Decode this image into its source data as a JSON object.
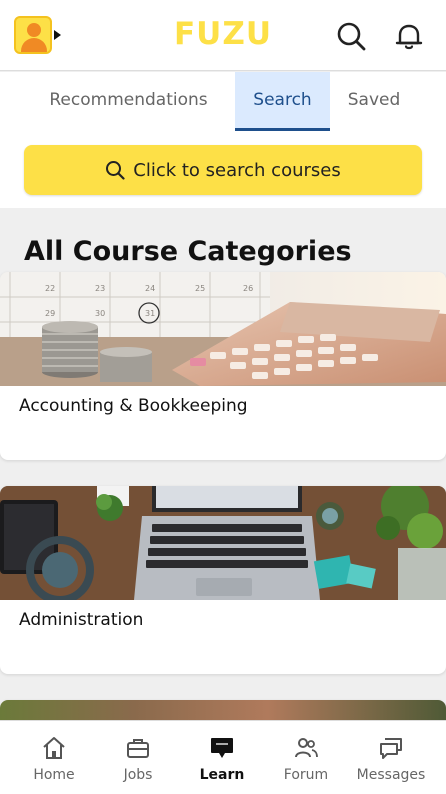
{
  "header": {
    "brand": "FUZU",
    "icons": [
      "avatar-icon",
      "search-icon",
      "bell-icon"
    ],
    "brand_color": "#fde047"
  },
  "tabs": [
    {
      "label": "Recommendations",
      "active": false
    },
    {
      "label": "Search",
      "active": true
    },
    {
      "label": "Saved",
      "active": false
    }
  ],
  "search": {
    "button_label": "Click to search courses",
    "icon": "search-icon"
  },
  "main": {
    "section_title": "All Course Categories",
    "categories": [
      {
        "label": "Accounting & Bookkeeping",
        "image": "calendar-calculator-coins"
      },
      {
        "label": "Administration",
        "image": "laptop-desk-plants"
      }
    ]
  },
  "bottom_nav": [
    {
      "label": "Home",
      "icon": "home-icon",
      "active": false
    },
    {
      "label": "Jobs",
      "icon": "briefcase-icon",
      "active": false
    },
    {
      "label": "Learn",
      "icon": "chalkboard-icon",
      "active": true
    },
    {
      "label": "Forum",
      "icon": "people-icon",
      "active": false
    },
    {
      "label": "Messages",
      "icon": "chat-icon",
      "active": false
    }
  ],
  "colors": {
    "accent_yellow": "#fde047",
    "active_tab_bg": "#dbeafe",
    "active_tab_text": "#1e4f8c"
  }
}
